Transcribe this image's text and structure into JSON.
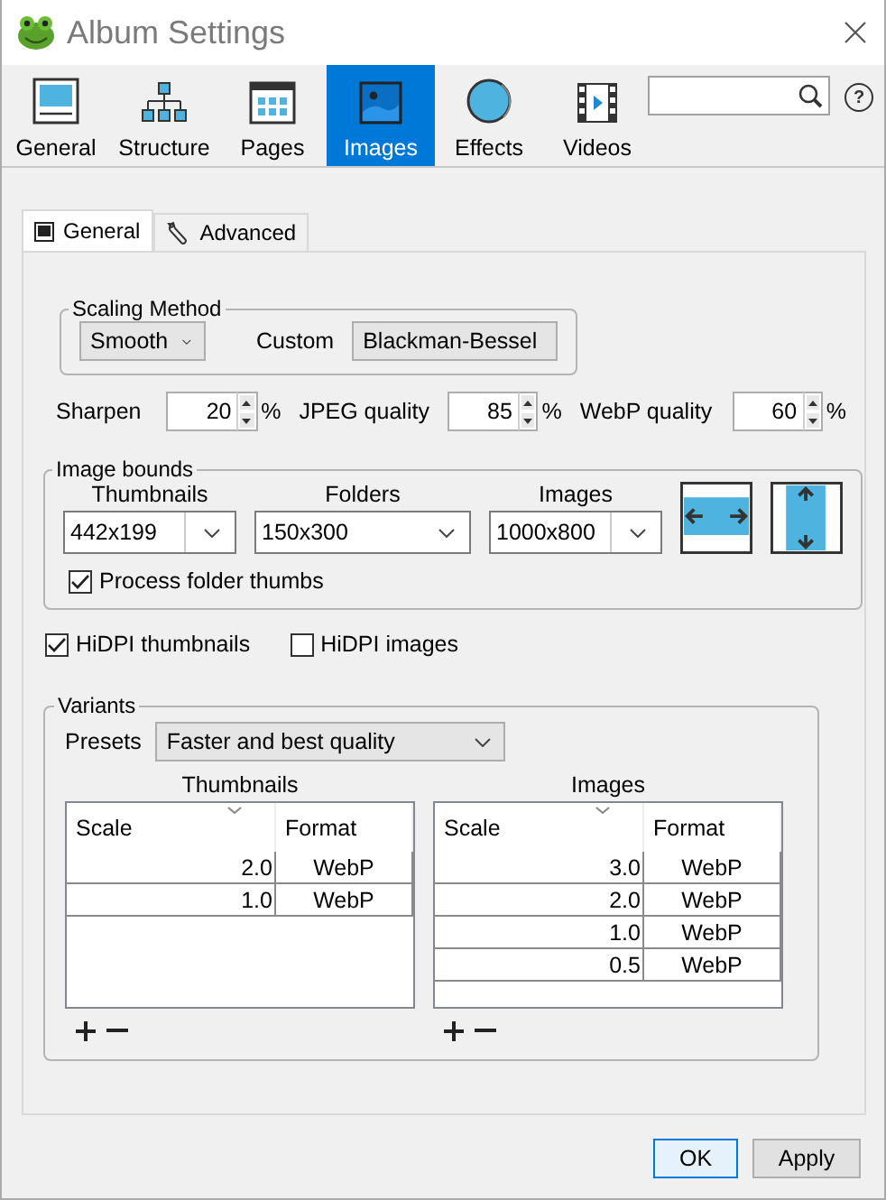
{
  "window": {
    "title": "Album Settings"
  },
  "toolbar": {
    "tabs": [
      {
        "label": "General",
        "selected": false
      },
      {
        "label": "Structure",
        "selected": false
      },
      {
        "label": "Pages",
        "selected": false
      },
      {
        "label": "Images",
        "selected": true
      },
      {
        "label": "Effects",
        "selected": false
      },
      {
        "label": "Videos",
        "selected": false
      }
    ],
    "help": "?"
  },
  "subtabs": [
    {
      "label": "General",
      "selected": true
    },
    {
      "label": "Advanced",
      "selected": false
    }
  ],
  "scaling_method": {
    "legend": "Scaling Method",
    "method": "Smooth",
    "custom_label": "Custom",
    "custom_value": "Blackman-Bessel"
  },
  "quality": [
    {
      "label": "Sharpen",
      "value": "20",
      "unit": "%"
    },
    {
      "label": "JPEG quality",
      "value": "85",
      "unit": "%"
    },
    {
      "label": "WebP quality",
      "value": "60",
      "unit": "%"
    }
  ],
  "image_bounds": {
    "legend": "Image bounds",
    "fields": [
      {
        "label": "Thumbnails",
        "value": "442x199",
        "kind": "combo"
      },
      {
        "label": "Folders",
        "value": "150x300",
        "kind": "list"
      },
      {
        "label": "Images",
        "value": "1000x800",
        "kind": "combo"
      }
    ],
    "process_folder_thumbs": {
      "label": "Process folder thumbs",
      "checked": true
    }
  },
  "hidpi": [
    {
      "label": "HiDPI thumbnails",
      "checked": true
    },
    {
      "label": "HiDPI images",
      "checked": false
    }
  ],
  "variants": {
    "legend": "Variants",
    "presets_label": "Presets",
    "preset": "Faster and best quality",
    "tables": [
      {
        "title": "Thumbnails",
        "columns": [
          "Scale",
          "Format"
        ],
        "rows": [
          [
            "2.0",
            "WebP"
          ],
          [
            "1.0",
            "WebP"
          ]
        ]
      },
      {
        "title": "Images",
        "columns": [
          "Scale",
          "Format"
        ],
        "rows": [
          [
            "3.0",
            "WebP"
          ],
          [
            "2.0",
            "WebP"
          ],
          [
            "1.0",
            "WebP"
          ],
          [
            "0.5",
            "WebP"
          ]
        ]
      }
    ]
  },
  "buttons": [
    {
      "label": "OK",
      "default": true
    },
    {
      "label": "Apply",
      "default": false
    }
  ]
}
